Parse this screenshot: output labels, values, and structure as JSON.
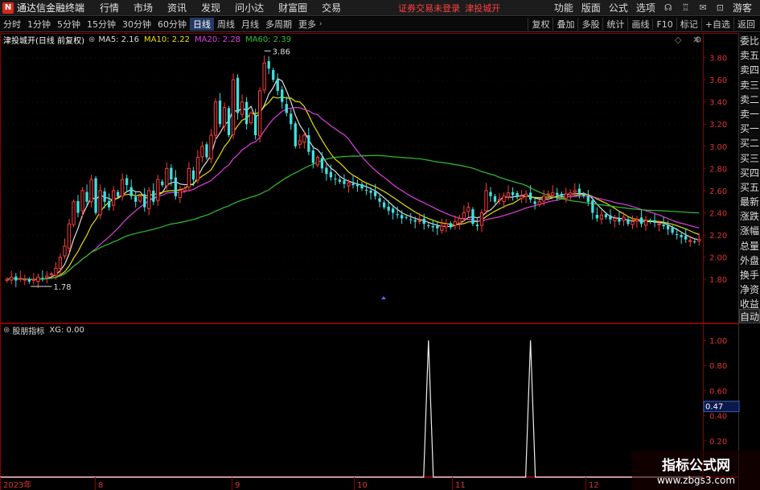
{
  "menubar": {
    "logo_glyph": "N",
    "app_name": "通达信金融终端",
    "items": [
      "行情",
      "市场",
      "资讯",
      "发现",
      "问小达",
      "财富圈",
      "交易"
    ],
    "alert": "证券交易未登录",
    "stock_name": "津投城开",
    "right_items": [
      "功能",
      "版面",
      "公式",
      "选项"
    ],
    "user": "游客"
  },
  "toolbar": {
    "periods": [
      "分时",
      "1分钟",
      "5分钟",
      "15分钟",
      "30分钟",
      "60分钟",
      "日线",
      "周线",
      "月线",
      "多周期",
      "更多"
    ],
    "active_period": "日线",
    "right_buttons": [
      "复权",
      "叠加",
      "多股",
      "统计",
      "画线",
      "F10",
      "标记",
      "+自选",
      "返回"
    ]
  },
  "main_legend": {
    "title": "津投城开(日线 前复权)",
    "ma": [
      {
        "label": "MA5: 2.16",
        "color": "#dddddd"
      },
      {
        "label": "MA10: 2.22",
        "color": "#e8e000"
      },
      {
        "label": "MA20: 2.28",
        "color": "#e040e0"
      },
      {
        "label": "MA60: 2.39",
        "color": "#30c030"
      }
    ]
  },
  "sub_legend": {
    "title": "股朋指标",
    "value": "XG: 0.00"
  },
  "sidebar_items": [
    "委比",
    "卖五",
    "卖四",
    "卖三",
    "卖二",
    "卖一",
    "买一",
    "买二",
    "买三",
    "买四",
    "买五",
    "最新",
    "涨跌",
    "涨幅",
    "总量",
    "外盘",
    "换手",
    "净资",
    "收益"
  ],
  "sidebar_auto": "自动",
  "price_axis": [
    "3.80",
    "3.60",
    "3.40",
    "3.20",
    "3.00",
    "2.80",
    "2.60",
    "2.40",
    "2.20",
    "2.00",
    "1.80"
  ],
  "sub_axis": [
    "1.00",
    "0.80",
    "0.60",
    "0.40",
    "0.20"
  ],
  "sub_current_value": "0.47",
  "annotations": {
    "high": "3.86",
    "low": "1.78"
  },
  "date_axis": [
    "2023年",
    "8",
    "9",
    "10",
    "11",
    "12"
  ],
  "watermark": {
    "line1": "指标公式网",
    "line2": "www.zbgs3.com"
  },
  "colors": {
    "up": "#ff3a3a",
    "down": "#40e0e0",
    "ma5": "#dddddd",
    "ma10": "#e8e000",
    "ma20": "#e040e0",
    "ma60": "#30c030",
    "grid": "#8a0000"
  },
  "chart_data": {
    "type": "candlestick",
    "price_range": [
      1.7,
      3.92
    ],
    "high": 3.86,
    "low": 1.78,
    "signal_peaks": [
      {
        "index": 95,
        "value": 1.0
      },
      {
        "index": 118,
        "value": 1.0
      }
    ],
    "closes": [
      1.8,
      1.82,
      1.79,
      1.81,
      1.8,
      1.78,
      1.8,
      1.82,
      1.81,
      1.83,
      1.85,
      1.9,
      2.0,
      2.1,
      2.3,
      2.5,
      2.4,
      2.6,
      2.5,
      2.7,
      2.4,
      2.6,
      2.5,
      2.45,
      2.6,
      2.55,
      2.7,
      2.65,
      2.55,
      2.5,
      2.55,
      2.45,
      2.6,
      2.5,
      2.7,
      2.65,
      2.8,
      2.7,
      2.55,
      2.6,
      2.62,
      2.8,
      2.7,
      2.9,
      3.0,
      2.9,
      3.1,
      3.4,
      3.2,
      3.35,
      3.1,
      3.6,
      3.3,
      3.4,
      3.2,
      3.3,
      3.1,
      3.5,
      3.75,
      3.7,
      3.6,
      3.5,
      3.4,
      3.3,
      3.2,
      3.0,
      3.05,
      3.1,
      2.95,
      2.85,
      2.9,
      2.8,
      2.75,
      2.72,
      2.7,
      2.68,
      2.66,
      2.67,
      2.65,
      2.64,
      2.62,
      2.6,
      2.58,
      2.55,
      2.5,
      2.45,
      2.42,
      2.4,
      2.38,
      2.35,
      2.36,
      2.34,
      2.32,
      2.33,
      2.3,
      2.28,
      2.27,
      2.26,
      2.28,
      2.3,
      2.27,
      2.32,
      2.35,
      2.4,
      2.45,
      2.3,
      2.28,
      2.4,
      2.6,
      2.55,
      2.5,
      2.52,
      2.55,
      2.58,
      2.56,
      2.54,
      2.55,
      2.57,
      2.52,
      2.48,
      2.5,
      2.55,
      2.57,
      2.58,
      2.56,
      2.55,
      2.57,
      2.58,
      2.6,
      2.58,
      2.55,
      2.5,
      2.4,
      2.35,
      2.38,
      2.36,
      2.34,
      2.35,
      2.32,
      2.36,
      2.3,
      2.32,
      2.34,
      2.3,
      2.33,
      2.32,
      2.31,
      2.3,
      2.28,
      2.25,
      2.22,
      2.2,
      2.18,
      2.16,
      2.15,
      2.14,
      2.16
    ]
  }
}
